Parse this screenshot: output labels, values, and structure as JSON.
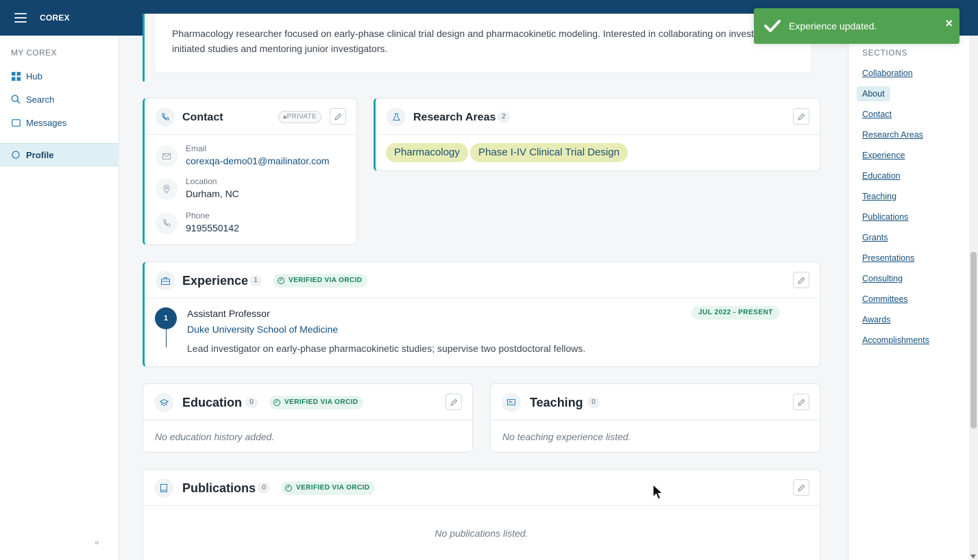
{
  "app": {
    "brand": "COREX"
  },
  "sidebar": {
    "heading": "MY COREX",
    "items": [
      {
        "label": "Hub",
        "icon": "grid-icon"
      },
      {
        "label": "Search",
        "icon": "search-icon"
      },
      {
        "label": "Messages",
        "icon": "message-icon"
      },
      {
        "label": "Profile",
        "icon": "circle-icon",
        "active": true
      }
    ],
    "collapse_label": "«"
  },
  "about": {
    "text_line1": "Pharmacology researcher focused on early-phase clinical trial design and pharmacokinetic modeling. Interested in collaborating on investigator-",
    "text_line2": "initiated studies and mentoring junior investigators."
  },
  "contact": {
    "title": "Contact",
    "private_label": "PRIVATE",
    "email_label": "Email",
    "email_value": "corexqa-demo01@mailinator.com",
    "location_label": "Location",
    "location_value": "Durham, NC",
    "phone_label": "Phone",
    "phone_value": "9195550142"
  },
  "research": {
    "title": "Research Areas",
    "count": "2",
    "tags": [
      "Pharmacology",
      "Phase I-IV Clinical Trial Design"
    ]
  },
  "experience": {
    "title": "Experience",
    "count": "1",
    "verified": "VERIFIED VIA ORCID",
    "items": [
      {
        "index": "1",
        "role": "Assistant Professor",
        "org": "Duke University School of Medicine",
        "dates": "JUL 2022 - PRESENT",
        "desc": "Lead investigator on early-phase pharmacokinetic studies; supervise two postdoctoral fellows."
      }
    ]
  },
  "education": {
    "title": "Education",
    "count": "0",
    "verified": "VERIFIED VIA ORCID",
    "empty": "No education history added."
  },
  "teaching": {
    "title": "Teaching",
    "count": "0",
    "empty": "No teaching experience listed."
  },
  "publications": {
    "title": "Publications",
    "count": "0",
    "verified": "VERIFIED VIA ORCID",
    "empty": "No publications listed."
  },
  "sections_nav": {
    "heading": "SECTIONS",
    "links": [
      "Collaboration",
      "About",
      "Contact",
      "Research Areas",
      "Experience",
      "Education",
      "Teaching",
      "Publications",
      "Grants",
      "Presentations",
      "Consulting",
      "Committees",
      "Awards",
      "Accomplishments"
    ],
    "active": "About"
  },
  "toast": {
    "message": "Experience updated.",
    "close": "×"
  },
  "colors": {
    "topbar": "#13446e",
    "accent": "#1aa3b5",
    "link": "#16507e",
    "toast": "#51a351",
    "tag_bg": "#e7ecb4"
  }
}
